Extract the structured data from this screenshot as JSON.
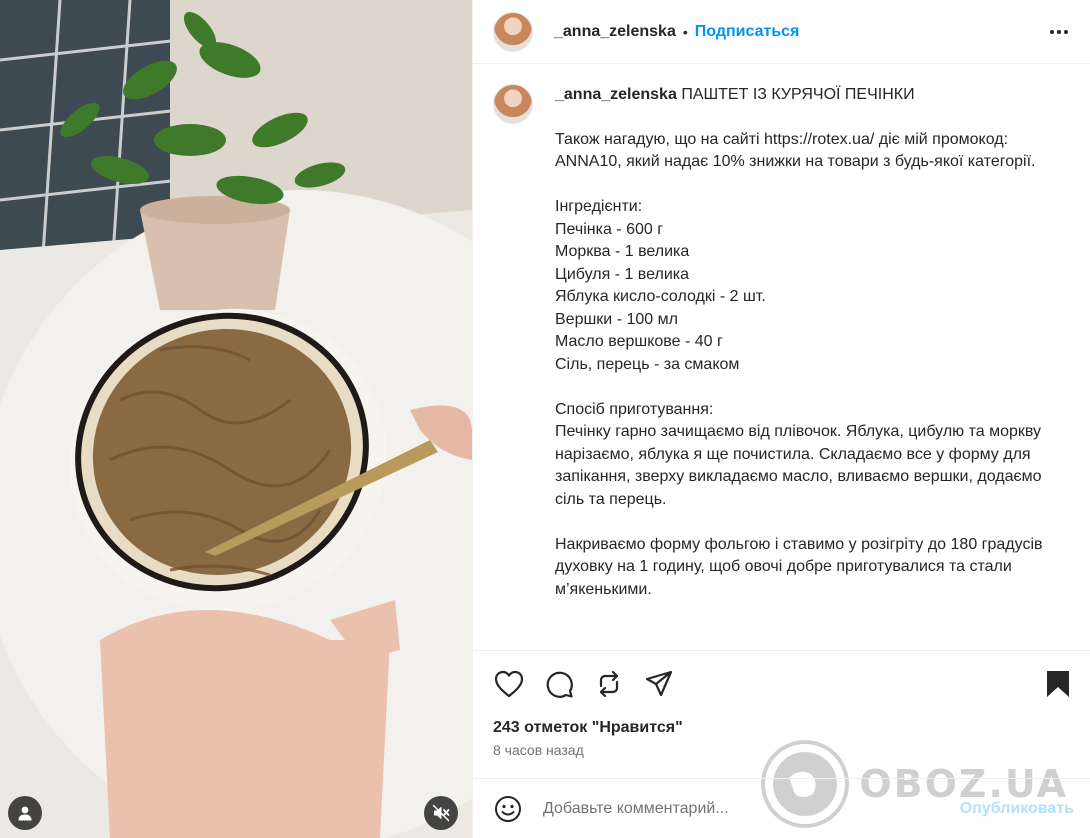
{
  "post": {
    "username": "_anna_zelenska",
    "separator": "•",
    "follow_label": "Подписаться",
    "caption_title": "ПАШТЕТ ІЗ КУРЯЧОЇ ПЕЧІНКИ",
    "caption_body": "Також нагадую, що на сайті https://rotex.ua/ діє мій промокод: ANNA10, який надає 10% знижки на товари з будь-якої категорії.\n\nІнгредієнти:\nПечінка - 600 г\nМорква - 1 велика\nЦибуля - 1 велика\nЯблука кисло-солодкі - 2 шт.\nВершки - 100 мл\nМасло вершкове - 40 г\nСіль, перець - за смаком\n\nСпосіб приготування:\nПечінку гарно зачищаємо від плівочок. Яблука, цибулю та моркву нарізаємо, яблука я ще почистила. Складаємо все у форму для запікання, зверху викладаємо масло, вливаємо вершки, додаємо сіль та перець.\n\nНакриваємо форму фольгою і ставимо у розігріту до 180 градусів духовку на 1 годину, щоб овочі добре приготувалися та стали м’якенькими.",
    "likes_text": "243 отметок \"Нравится\"",
    "time_text": "8 часов назад"
  },
  "comment": {
    "placeholder": "Добавьте комментарий...",
    "publish_label": "Опубликовать"
  },
  "watermark": {
    "text": "OBOZ.UA"
  },
  "icons": {
    "like": "heart-icon",
    "comment": "comment-icon",
    "repost": "repost-icon",
    "share": "share-icon",
    "save": "bookmark-icon",
    "more": "more-icon",
    "emoji": "emoji-icon",
    "tag": "user-tag-icon",
    "mute": "sound-off-icon"
  },
  "colors": {
    "accent": "#0095f6",
    "publish_disabled": "#b2dffc",
    "text": "#262626",
    "muted": "#737373"
  }
}
